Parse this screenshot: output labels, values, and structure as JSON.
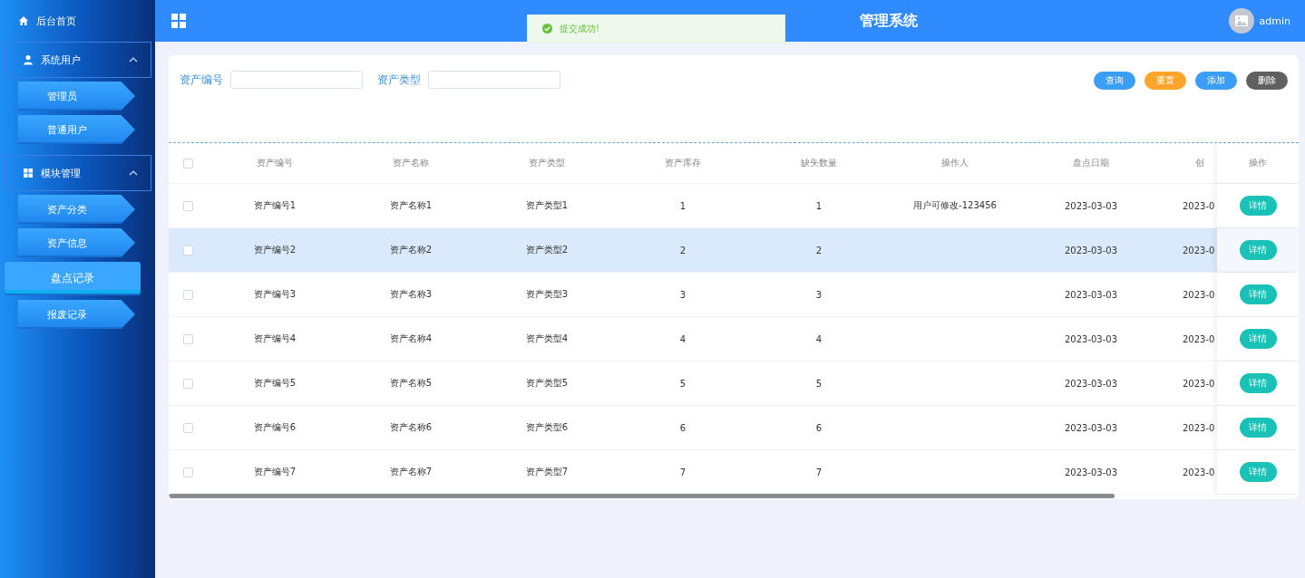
{
  "sidebar": {
    "home": {
      "label": "后台首页"
    },
    "groups": [
      {
        "label": "系统用户",
        "kind": "user",
        "expanded": true,
        "items": [
          {
            "label": "管理员",
            "selected": false
          },
          {
            "label": "普通用户",
            "selected": false
          }
        ]
      },
      {
        "label": "模块管理",
        "kind": "grid",
        "expanded": true,
        "items": [
          {
            "label": "资产分类",
            "selected": false
          },
          {
            "label": "资产信息",
            "selected": false
          },
          {
            "label": "盘点记录",
            "selected": true
          },
          {
            "label": "报废记录",
            "selected": false
          }
        ]
      }
    ]
  },
  "header": {
    "title": "管理系统",
    "user": "admin"
  },
  "toast": {
    "message": "提交成功!"
  },
  "search": {
    "fields": [
      {
        "label": "资产编号"
      },
      {
        "label": "资产类型"
      }
    ],
    "buttons": [
      {
        "label": "查询",
        "color": "#3a9ef5"
      },
      {
        "label": "重置",
        "color": "#ffa52b"
      },
      {
        "label": "添加",
        "color": "#3a9ef5"
      },
      {
        "label": "删除",
        "color": "#606060"
      }
    ]
  },
  "table": {
    "select_all": {
      "checked": false
    },
    "columns": [
      "资产编号",
      "资产名称",
      "资产类型",
      "资产库存",
      "缺失数量",
      "操作人",
      "盘点日期",
      "创"
    ],
    "action_column": "操作",
    "rows": [
      {
        "checked": false,
        "highlighted": false,
        "cells": [
          "资产编号1",
          "资产名称1",
          "资产类型1",
          "1",
          "1",
          "用户可修改-123456",
          "2023-03-03",
          "2023-0"
        ],
        "action": "详情"
      },
      {
        "checked": false,
        "highlighted": true,
        "cells": [
          "资产编号2",
          "资产名称2",
          "资产类型2",
          "2",
          "2",
          "",
          "2023-03-03",
          "2023-0"
        ],
        "action": "详情"
      },
      {
        "checked": false,
        "highlighted": false,
        "cells": [
          "资产编号3",
          "资产名称3",
          "资产类型3",
          "3",
          "3",
          "",
          "2023-03-03",
          "2023-0"
        ],
        "action": "详情"
      },
      {
        "checked": false,
        "highlighted": false,
        "cells": [
          "资产编号4",
          "资产名称4",
          "资产类型4",
          "4",
          "4",
          "",
          "2023-03-03",
          "2023-0"
        ],
        "action": "详情"
      },
      {
        "checked": false,
        "highlighted": false,
        "cells": [
          "资产编号5",
          "资产名称5",
          "资产类型5",
          "5",
          "5",
          "",
          "2023-03-03",
          "2023-0"
        ],
        "action": "详情"
      },
      {
        "checked": false,
        "highlighted": false,
        "cells": [
          "资产编号6",
          "资产名称6",
          "资产类型6",
          "6",
          "6",
          "",
          "2023-03-03",
          "2023-0"
        ],
        "action": "详情"
      },
      {
        "checked": false,
        "highlighted": false,
        "cells": [
          "资产编号7",
          "资产名称7",
          "资产类型7",
          "7",
          "7",
          "",
          "2023-03-03",
          "2023-0"
        ],
        "action": "详情"
      }
    ]
  }
}
